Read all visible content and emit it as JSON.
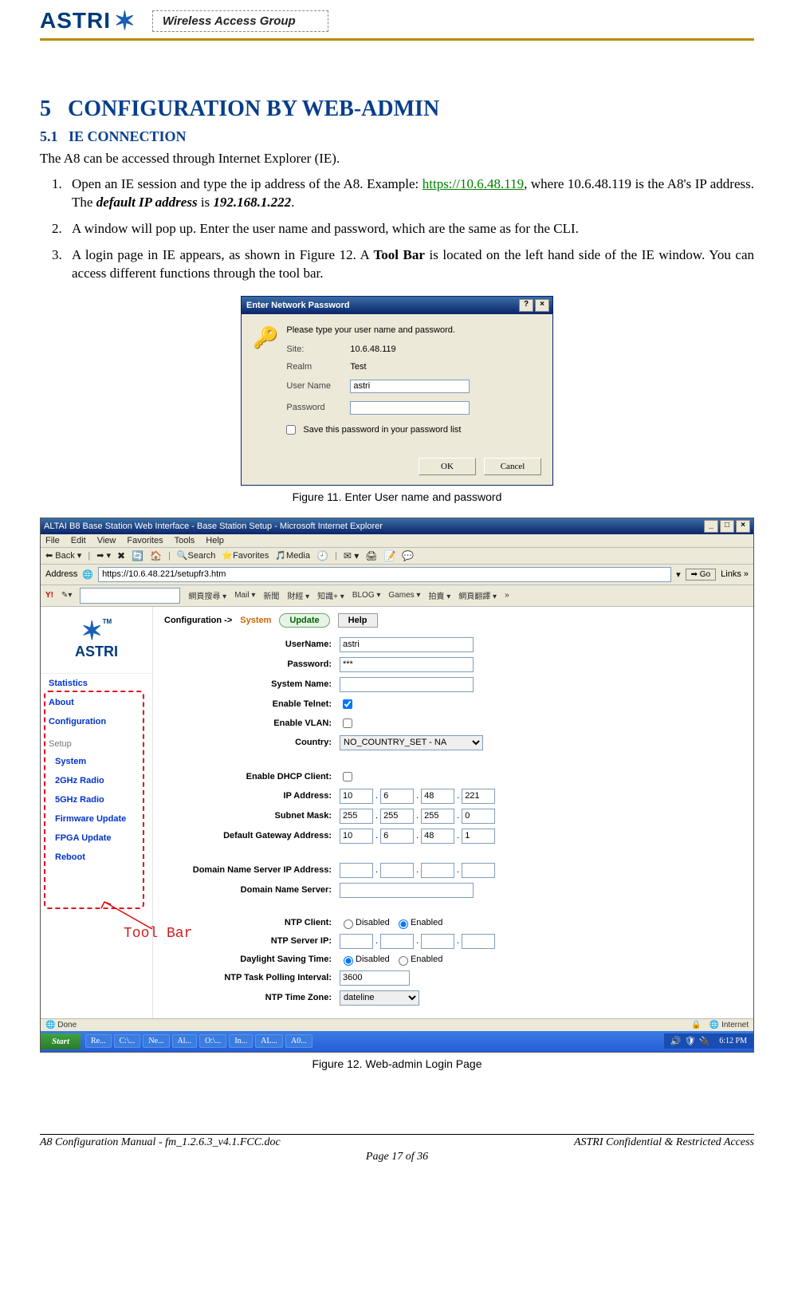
{
  "header": {
    "logo_text": "ASTRI",
    "wag_label": "Wireless Access Group"
  },
  "headings": {
    "h1_num": "5",
    "h1_text": "CONFIGURATION BY WEB-ADMIN",
    "h2_num": "5.1",
    "h2_text": "IE CONNECTION"
  },
  "intro": "The A8 can be accessed through Internet Explorer (IE).",
  "list": {
    "item1_pre": "Open an IE session and type the ip address of the A8. Example: ",
    "item1_link": "https://10.6.48.119",
    "item1_post1": ", where 10.6.48.119 is the A8's IP address. The ",
    "item1_bi1": "default IP address",
    "item1_post2": " is ",
    "item1_bi2": "192.168.1.222",
    "item1_post3": ".",
    "item2": "A window will pop up. Enter the user name and password, which are the same as for the CLI.",
    "item3_pre": "A login page in IE appears, as shown in Figure 12. A ",
    "item3_b": "Tool Bar",
    "item3_post": " is located on the left hand side of the IE window. You can access different functions through the tool bar."
  },
  "fig11_caption": "Figure 11. Enter User name and password",
  "fig12_caption": "Figure 12. Web-admin Login Page",
  "annot_toolbar": "Tool Bar",
  "dialog": {
    "title": "Enter Network Password",
    "help_btn": "?",
    "close_btn": "×",
    "prompt": "Please type your user name and password.",
    "site_label": "Site:",
    "site_value": "10.6.48.119",
    "realm_label": "Realm",
    "realm_value": "Test",
    "user_label": "User Name",
    "user_value": "astri",
    "pass_label": "Password",
    "pass_value": "",
    "save_label": "Save this password in your password list",
    "ok": "OK",
    "cancel": "Cancel"
  },
  "ie": {
    "title": "ALTAI B8 Base Station Web Interface - Base Station Setup - Microsoft Internet Explorer",
    "min": "_",
    "max": "□",
    "close": "×",
    "menu": [
      "File",
      "Edit",
      "View",
      "Favorites",
      "Tools",
      "Help"
    ],
    "tool_back": "Back",
    "tool_search": "Search",
    "tool_fav": "Favorites",
    "tool_media": "Media",
    "addr_label": "Address",
    "addr_value": "https://10.6.48.221/setupfr3.htm",
    "go": "Go",
    "links": "Links »",
    "ytool": {
      "ylogo": "Y!",
      "items": [
        "網頁搜尋 ▾",
        "",
        "Mail ▾",
        "新聞",
        "財經 ▾",
        "知識+ ▾",
        "BLOG ▾",
        "Games ▾",
        "拍賣 ▾",
        "網頁翻譯 ▾",
        "»"
      ]
    },
    "sidebar": {
      "logo": "ASTRI",
      "tm": "TM",
      "top": [
        "Statistics",
        "About",
        "Configuration"
      ],
      "setup_title": "Setup",
      "setup": [
        "System",
        "2GHz Radio",
        "5GHz Radio",
        "Firmware Update",
        "FPGA Update",
        "Reboot"
      ]
    },
    "main": {
      "crumb_pre": "Configuration ->",
      "crumb_sys": "System",
      "update_btn": "Update",
      "help_btn": "Help",
      "rows": {
        "username_l": "UserName:",
        "username_v": "astri",
        "password_l": "Password:",
        "password_v": "***",
        "sysname_l": "System Name:",
        "sysname_v": "",
        "telnet_l": "Enable Telnet:",
        "vlan_l": "Enable VLAN:",
        "country_l": "Country:",
        "country_v": "NO_COUNTRY_SET - NA",
        "dhcp_l": "Enable DHCP Client:",
        "ip_l": "IP Address:",
        "ip": [
          "10",
          "6",
          "48",
          "221"
        ],
        "mask_l": "Subnet Mask:",
        "mask": [
          "255",
          "255",
          "255",
          "0"
        ],
        "gw_l": "Default Gateway Address:",
        "gw": [
          "10",
          "6",
          "48",
          "1"
        ],
        "dnsip_l": "Domain Name Server IP Address:",
        "dnsip": [
          "",
          "",
          "",
          ""
        ],
        "dnsname_l": "Domain Name Server:",
        "dnsname_v": "",
        "ntpc_l": "NTP Client:",
        "ntpc_dis": "Disabled",
        "ntpc_en": "Enabled",
        "ntpsrv_l": "NTP Server IP:",
        "ntpsrv": [
          "",
          "",
          "",
          ""
        ],
        "dst_l": "Daylight Saving Time:",
        "dst_dis": "Disabled",
        "dst_en": "Enabled",
        "ntpint_l": "NTP Task Polling Interval:",
        "ntpint_v": "3600",
        "ntptz_l": "NTP Time Zone:",
        "ntptz_v": "dateline"
      }
    },
    "status_done": "Done",
    "status_zone": "Internet",
    "taskbar": {
      "start": "Start",
      "items": [
        "Re...",
        "C:\\...",
        "Ne...",
        "Al...",
        "O:\\...",
        "In...",
        "AL...",
        "A0..."
      ],
      "clock": "6:12 PM"
    }
  },
  "footer": {
    "left": "A8 Configuration Manual - fm_1.2.6.3_v4.1.FCC.doc",
    "right": "ASTRI Confidential & Restricted Access",
    "center": "Page 17 of 36"
  }
}
